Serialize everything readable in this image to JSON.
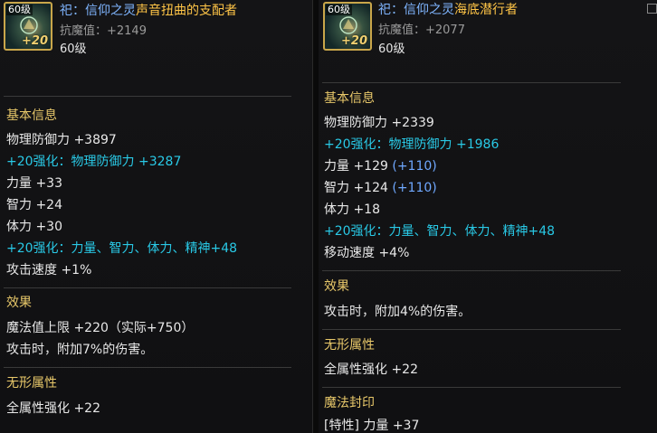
{
  "left": {
    "icon": {
      "level_tag": "60级",
      "reinforce_tag": "+20",
      "icon_name": "spirit-orb-icon"
    },
    "title_prefix": "祀：信仰之灵",
    "title_name": "声音扭曲的支配者",
    "resist_magic": "抗魔值：+2149",
    "level": "60级",
    "sections": {
      "basic_header": "基本信息",
      "basic": [
        "物理防御力 +3897",
        "+20强化：物理防御力 +3287",
        "力量 +33",
        "智力 +24",
        "体力 +30",
        "+20强化：力量、智力、体力、精神+48",
        "攻击速度 +1%"
      ],
      "effect_header": "效果",
      "effect": [
        "魔法值上限 +220（实际+750）",
        "攻击时，附加7%的伤害。"
      ],
      "formless_header": "无形属性",
      "formless": [
        "全属性强化 +22"
      ]
    }
  },
  "right": {
    "icon": {
      "level_tag": "60级",
      "reinforce_tag": "+20",
      "icon_name": "spirit-orb-icon"
    },
    "title_prefix": "祀：信仰之灵",
    "title_name": "海底潜行者",
    "resist_magic": "抗魔值：+2077",
    "level": "60级",
    "sections": {
      "basic_header": "基本信息",
      "basic": [
        {
          "text": "物理防御力 +2339",
          "extra": ""
        },
        {
          "text": "+20强化：物理防御力 +1986",
          "extra": ""
        },
        {
          "text": "力量 +129 ",
          "extra": "(+110)"
        },
        {
          "text": "智力 +124 ",
          "extra": "(+110)"
        },
        {
          "text": "体力 +18",
          "extra": ""
        },
        {
          "text": "+20强化：力量、智力、体力、精神+48",
          "extra": ""
        },
        {
          "text": "移动速度 +4%",
          "extra": ""
        }
      ],
      "effect_header": "效果",
      "effect": [
        "攻击时，附加4%的伤害。"
      ],
      "formless_header": "无形属性",
      "formless": [
        "全属性强化 +22"
      ],
      "seal_header": "魔法封印",
      "seal": [
        "[特性] 力量 +37"
      ]
    }
  },
  "colors": {
    "title_prefix": "#7fb5ff",
    "title_name": "#ffc547",
    "section_header": "#e8c86a",
    "reinforce_text": "#29c9e6",
    "bonus_text": "#6fa8ff",
    "stat_text": "#e8e8e8",
    "meta_text": "#9a9a9a"
  }
}
